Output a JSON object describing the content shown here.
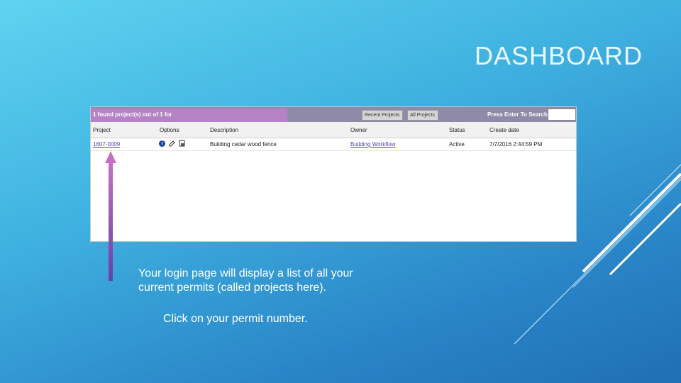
{
  "slide": {
    "title": "DASHBOARD",
    "caption_line1": "Your login page will display a list of all your",
    "caption_line2": "current permits (called projects here).",
    "caption_line3": "Click on your permit number."
  },
  "app": {
    "found_text": "1 found project(s) out of 1 for",
    "recent_button": "Recent Projects",
    "all_button": "All Projects",
    "search_label": "Press Enter To Search:",
    "search_value": "",
    "columns": [
      "Project",
      "Options",
      "Description",
      "Owner",
      "Status",
      "Create date"
    ],
    "rows": [
      {
        "project": "1607-0009",
        "description": "Building cedar wood fence",
        "owner": "Building Workflow",
        "status": "Active",
        "create_date": "7/7/2016 2:44:59 PM"
      }
    ]
  },
  "colors": {
    "arrow": "#b35fc0",
    "highlight": "#b583c4",
    "topbar": "#8e8aa8"
  },
  "icons": [
    "info-icon",
    "edit-icon",
    "print-icon"
  ]
}
